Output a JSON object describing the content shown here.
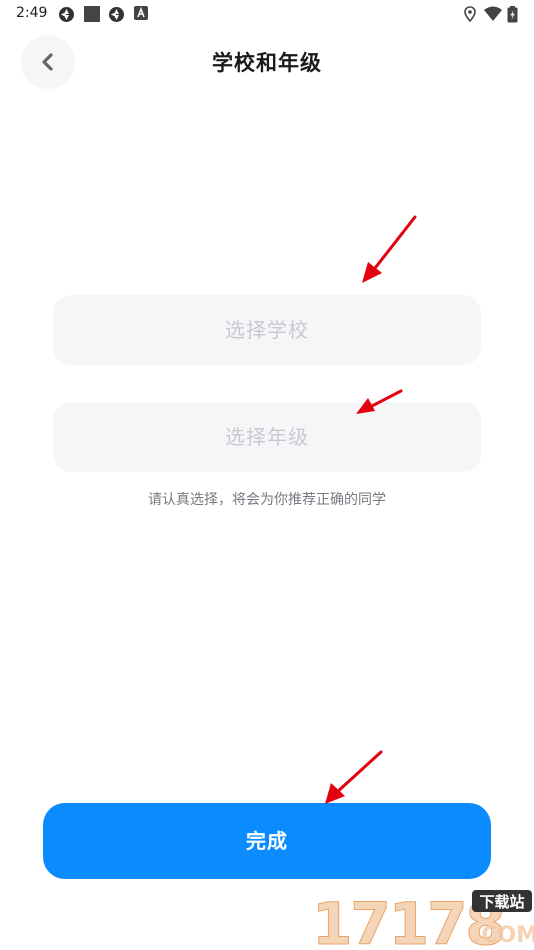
{
  "status_bar": {
    "time": "2:49",
    "left_icons": [
      "aperture-icon",
      "square-icon",
      "aperture-icon",
      "a-badge-icon"
    ],
    "right_icons": [
      "location-icon",
      "wifi-icon",
      "battery-icon"
    ]
  },
  "header": {
    "title": "学校和年级",
    "back_icon": "chevron-left-icon"
  },
  "form": {
    "school_placeholder": "选择学校",
    "grade_placeholder": "选择年级",
    "hint": "请认真选择，将会为你推荐正确的同学"
  },
  "footer": {
    "done_label": "完成"
  },
  "watermark": {
    "text": "17178",
    "badge": "下载站",
    "suffix": ".COM"
  },
  "colors": {
    "accent": "#0a8cff",
    "field_bg": "#f5f6f7",
    "placeholder": "#c8cacf",
    "annotation_arrow": "#e3000f"
  }
}
